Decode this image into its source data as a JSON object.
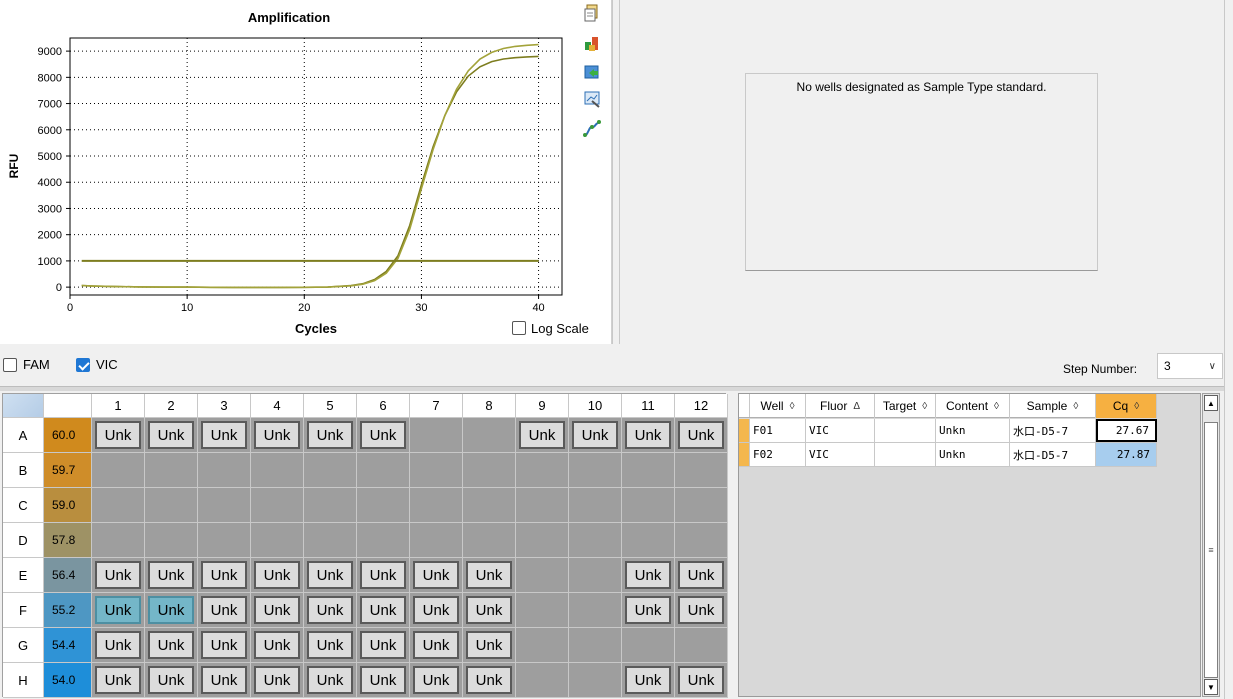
{
  "chart": {
    "title": "Amplification",
    "ylabel": "RFU",
    "xlabel": "Cycles",
    "log_scale_label": "Log Scale",
    "log_scale_checked": false
  },
  "chart_data": {
    "type": "line",
    "title": "Amplification",
    "xlabel": "Cycles",
    "ylabel": "RFU",
    "xlim": [
      0,
      42
    ],
    "ylim": [
      -300,
      9500
    ],
    "xticks": [
      0,
      10,
      20,
      30,
      40
    ],
    "yticks": [
      0,
      1000,
      2000,
      3000,
      4000,
      5000,
      6000,
      7000,
      8000,
      9000
    ],
    "grid": true,
    "series": [
      {
        "color": "#7d7d1f",
        "x": [
          1,
          2,
          4,
          6,
          8,
          10,
          12,
          14,
          16,
          18,
          20,
          22,
          24,
          25,
          26,
          27,
          28,
          29,
          30,
          31,
          32,
          33,
          34,
          35,
          36,
          37,
          38,
          39,
          40
        ],
        "y": [
          60,
          40,
          20,
          10,
          0,
          0,
          -5,
          -10,
          -10,
          -10,
          -5,
          0,
          60,
          130,
          290,
          600,
          1200,
          2350,
          3900,
          5350,
          6550,
          7450,
          8050,
          8400,
          8600,
          8700,
          8750,
          8780,
          8800
        ]
      },
      {
        "color": "#a3a33a",
        "x": [
          1,
          2,
          4,
          6,
          8,
          10,
          12,
          14,
          16,
          18,
          20,
          22,
          24,
          25,
          26,
          27,
          28,
          29,
          30,
          31,
          32,
          33,
          34,
          35,
          36,
          37,
          38,
          39,
          40
        ],
        "y": [
          60,
          40,
          20,
          10,
          0,
          0,
          -5,
          -10,
          -10,
          -10,
          -5,
          0,
          50,
          110,
          250,
          530,
          1100,
          2200,
          3750,
          5250,
          6550,
          7550,
          8250,
          8700,
          8950,
          9100,
          9180,
          9220,
          9250
        ]
      },
      {
        "name": "threshold",
        "color": "#7d7d1f",
        "x": [
          1,
          40
        ],
        "y": [
          1000,
          1000
        ]
      }
    ]
  },
  "tool_icons": [
    "copy-icon",
    "export-icon",
    "refresh-icon",
    "chart-settings-icon",
    "curve-icon"
  ],
  "standard_panel": {
    "message": "No wells designated as Sample Type standard."
  },
  "fluors": [
    {
      "label": "FAM",
      "checked": false
    },
    {
      "label": "VIC",
      "checked": true
    }
  ],
  "step": {
    "label": "Step Number:",
    "value": "3"
  },
  "plate": {
    "columns": [
      "1",
      "2",
      "3",
      "4",
      "5",
      "6",
      "7",
      "8",
      "9",
      "10",
      "11",
      "12"
    ],
    "rows": [
      {
        "label": "A",
        "temp": "60.0",
        "temp_color": "#d08a1d",
        "wells": [
          "Unk",
          "Unk",
          "Unk",
          "Unk",
          "Unk",
          "Unk",
          "",
          "",
          "Unk",
          "Unk",
          "Unk",
          "Unk"
        ]
      },
      {
        "label": "B",
        "temp": "59.7",
        "temp_color": "#cf8d29",
        "wells": [
          "",
          "",
          "",
          "",
          "",
          "",
          "",
          "",
          "",
          "",
          "",
          ""
        ]
      },
      {
        "label": "C",
        "temp": "59.0",
        "temp_color": "#b98e3e",
        "wells": [
          "",
          "",
          "",
          "",
          "",
          "",
          "",
          "",
          "",
          "",
          "",
          ""
        ]
      },
      {
        "label": "D",
        "temp": "57.8",
        "temp_color": "#9e9265",
        "wells": [
          "",
          "",
          "",
          "",
          "",
          "",
          "",
          "",
          "",
          "",
          "",
          ""
        ]
      },
      {
        "label": "E",
        "temp": "56.4",
        "temp_color": "#7a95a0",
        "wells": [
          "Unk",
          "Unk",
          "Unk",
          "Unk",
          "Unk",
          "Unk",
          "Unk",
          "Unk",
          "",
          "",
          "Unk",
          "Unk"
        ]
      },
      {
        "label": "F",
        "temp": "55.2",
        "temp_color": "#4e97c3",
        "wells": [
          "Unk",
          "Unk",
          "Unk",
          "Unk",
          "Unk",
          "Unk",
          "Unk",
          "Unk",
          "",
          "",
          "Unk",
          "Unk"
        ],
        "selected": [
          0,
          1
        ]
      },
      {
        "label": "G",
        "temp": "54.4",
        "temp_color": "#2f93d6",
        "wells": [
          "Unk",
          "Unk",
          "Unk",
          "Unk",
          "Unk",
          "Unk",
          "Unk",
          "Unk",
          "",
          "",
          "",
          ""
        ]
      },
      {
        "label": "H",
        "temp": "54.0",
        "temp_color": "#1e8ed9",
        "wells": [
          "Unk",
          "Unk",
          "Unk",
          "Unk",
          "Unk",
          "Unk",
          "Unk",
          "Unk",
          "",
          "",
          "Unk",
          "Unk"
        ]
      }
    ]
  },
  "results_table": {
    "columns": [
      {
        "label": "Well",
        "sort": "◊"
      },
      {
        "label": "Fluor",
        "sort": "Δ"
      },
      {
        "label": "Target",
        "sort": "◊"
      },
      {
        "label": "Content",
        "sort": "◊"
      },
      {
        "label": "Sample",
        "sort": "◊"
      },
      {
        "label": "Cq",
        "sort": "◊"
      }
    ],
    "rows": [
      {
        "well": "F01",
        "fluor": "VIC",
        "target": "",
        "content": "Unkn",
        "sample": "水口-D5-7",
        "cq": "27.67"
      },
      {
        "well": "F02",
        "fluor": "VIC",
        "target": "",
        "content": "Unkn",
        "sample": "水口-D5-7",
        "cq": "27.87"
      }
    ]
  }
}
